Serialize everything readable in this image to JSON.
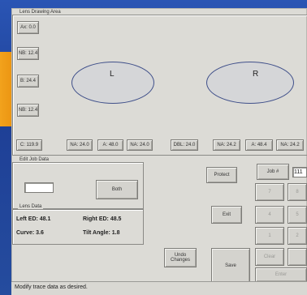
{
  "lens_drawing_area": {
    "title": "Lens Drawing Area",
    "left_buttons": [
      "Ax: 0.0",
      "NB: 12.4",
      "B: 24.4",
      "NB: 12.4"
    ],
    "left_lens": "L",
    "right_lens": "R",
    "bottom_buttons": [
      "C: 119.9",
      "NA: 24.0",
      "A: 48.0",
      "NA: 24.0",
      "DBL: 24.0",
      "NA: 24.2",
      "A: 48.4",
      "NA: 24.2"
    ]
  },
  "edit_job_data": {
    "title": "Edit Job Data",
    "input_value": "",
    "both_label": "Both"
  },
  "lens_data": {
    "title": "Lens Data",
    "left_ed": "Left ED: 48.1",
    "right_ed": "Right ED: 48.5",
    "curve": "Curve: 3.6",
    "tilt_angle": "Tilt Angle: 1.8"
  },
  "actions": {
    "protect": "Protect",
    "job_number": "Job #",
    "job_value": "111",
    "exit": "Exit",
    "save": "Save",
    "undo_changes": "Undo Changes",
    "clear": "Clear",
    "enter": "Enter"
  },
  "keypad": [
    "7",
    "8",
    "4",
    "5",
    "1",
    "2"
  ],
  "status_text": "Modify trace data as desired."
}
